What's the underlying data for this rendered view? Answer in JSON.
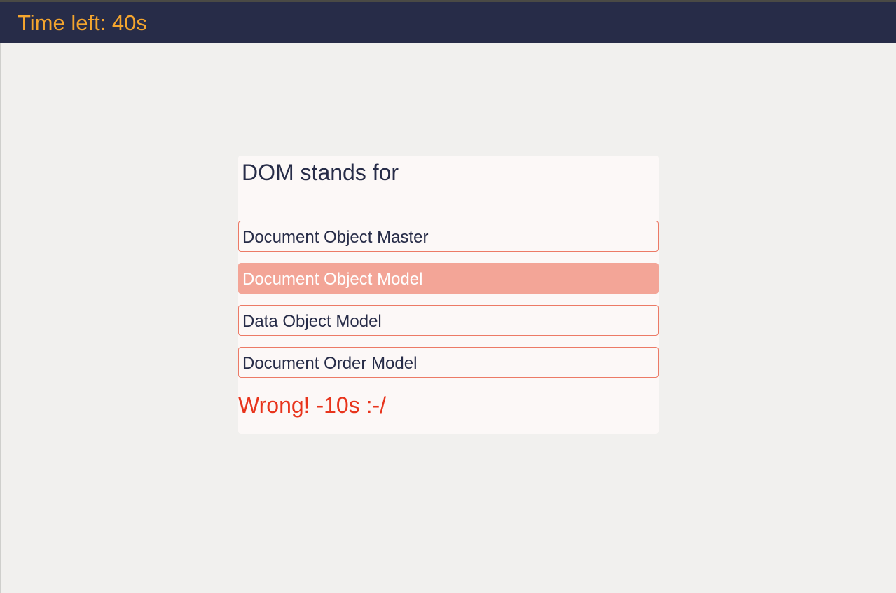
{
  "header": {
    "timer_text": "Time left: 40s"
  },
  "quiz": {
    "question": "DOM stands for",
    "choices": [
      {
        "label": "Document Object Master",
        "selected": false
      },
      {
        "label": "Document Object Model",
        "selected": true
      },
      {
        "label": "Data Object Model",
        "selected": false
      },
      {
        "label": "Document Order Model",
        "selected": false
      }
    ],
    "feedback": "Wrong! -10s :-/"
  },
  "colors": {
    "header_bg": "#272c48",
    "timer": "#f4a52e",
    "choice_border": "#ec7a66",
    "selected_bg": "#f3a597",
    "wrong_feedback": "#e8341c"
  }
}
